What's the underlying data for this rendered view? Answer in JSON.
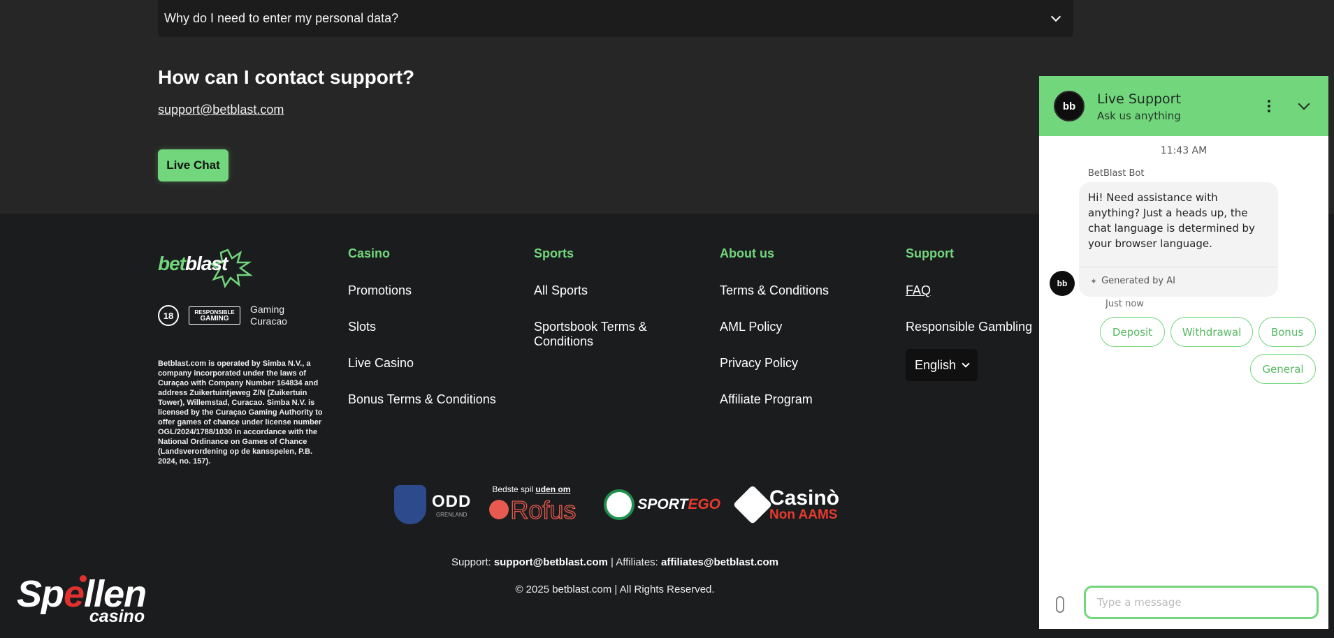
{
  "faq": {
    "question": "Why do I need to enter my personal data?"
  },
  "contact": {
    "heading": "How can I contact support?",
    "email": "support@betblast.com",
    "live_chat_label": "Live Chat"
  },
  "brand": {
    "logo_part1": "bet",
    "logo_part2": "blast"
  },
  "badges": {
    "age": "18",
    "rg_line1": "RESPONSIBLE",
    "rg_line2": "GAMING",
    "gaming_line1": "Gaming",
    "gaming_line2": "Curacao"
  },
  "legal_text": "Betblast.com  is operated by Simba N.V., a company incorporated under the laws of Curaçao with Company Number 164834 and address Zuikertuintjeweg Z/N (Zuikertuin Tower), Willemstad, Curacao. Simba N.V. is licensed by the Curaçao Gaming Authority to offer games of chance under license number OGL/2024/1788/1030 in accordance with the National Ordinance on Games of Chance (Landsverordening op de kansspelen, P.B. 2024, no. 157).",
  "columns": [
    {
      "title": "Casino",
      "links": [
        "Promotions",
        "Slots",
        "Live Casino",
        "Bonus Terms & Conditions"
      ]
    },
    {
      "title": "Sports",
      "links": [
        "All Sports",
        "Sportsbook Terms & Conditions"
      ]
    },
    {
      "title": "About us",
      "links": [
        "Terms & Conditions",
        "AML Policy",
        "Privacy Policy",
        "Affiliate Program"
      ]
    },
    {
      "title": "Support",
      "links": [
        "FAQ",
        "Responsible Gambling"
      ]
    }
  ],
  "language": "English",
  "partners": {
    "odd": "ODD",
    "odd_sub": "GRENLAND",
    "rofus_small": "Bedste spil",
    "rofus_small_bold": "uden om",
    "rofus": "Rofus",
    "sportego_a": "SPORT",
    "sportego_b": "EGO",
    "casino": "Casinò",
    "non_aams": "Non AAMS"
  },
  "footer": {
    "support_label": "Support:",
    "support_email": "support@betblast.com",
    "sep": "|",
    "affiliates_label": "Affiliates:",
    "affiliates_email": "affiliates@betblast.com",
    "copyright": "© 2025 betblast.com | All Rights Reserved."
  },
  "watermark": {
    "main_a": "Sp",
    "main_b": "e",
    "main_c": "llen",
    "sub": "casino"
  },
  "chat": {
    "title": "Live Support",
    "subtitle": "Ask us anything",
    "time": "11:43 AM",
    "bot_name": "BetBlast Bot",
    "message": "Hi! Need assistance with anything? Just a heads up, the chat language is determined by your browser language.",
    "ai_label": "Generated by AI",
    "just_now": "Just now",
    "chips": [
      "Deposit",
      "Withdrawal",
      "Bonus",
      "General"
    ],
    "input_placeholder": "Type a message",
    "avatar_text": "bb"
  },
  "colors": {
    "accent": "#72d67c",
    "background": "#1b1c1e",
    "top_background": "#262626",
    "red": "#e0312f"
  }
}
